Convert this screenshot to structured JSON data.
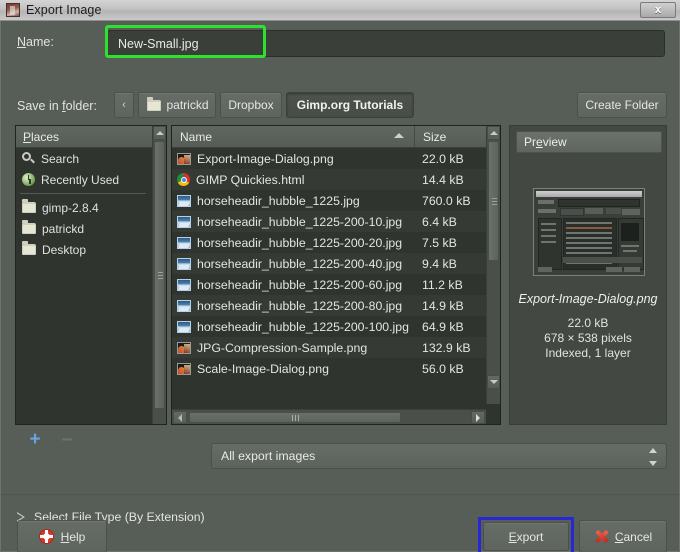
{
  "window": {
    "title": "Export Image",
    "icon": "gimp-wilber-icon",
    "close_label": "x"
  },
  "name_row": {
    "label": "Name:",
    "label_mnemonic": "N",
    "value": "New-Small.jpg",
    "placeholder": "",
    "highlight_color": "#2de12d"
  },
  "folder_row": {
    "label": "Save in folder:",
    "label_mnemonic": "f",
    "back_label": "‹",
    "crumbs": [
      {
        "label": "patrickd",
        "icon": "folder-icon",
        "active": false
      },
      {
        "label": "Dropbox",
        "icon": "",
        "active": false
      },
      {
        "label": "Gimp.org Tutorials",
        "icon": "",
        "active": true
      }
    ],
    "create_folder_label": "Create Folder"
  },
  "places": {
    "header": "Places",
    "header_mnemonic": "P",
    "items": [
      {
        "label": "Search",
        "icon": "search-icon"
      },
      {
        "label": "Recently Used",
        "icon": "recently-used-icon"
      },
      {
        "label": "gimp-2.8.4",
        "icon": "folder-icon"
      },
      {
        "label": "patrickd",
        "icon": "folder-icon"
      },
      {
        "label": "Desktop",
        "icon": "folder-icon"
      }
    ],
    "add_label": "+",
    "remove_label": "–"
  },
  "files": {
    "columns": [
      "Name",
      "Size"
    ],
    "sort_column": "Name",
    "sort_direction": "ascending",
    "rows": [
      {
        "name": "Export-Image-Dialog.png",
        "size": "22.0 kB",
        "icon": "png-image-icon"
      },
      {
        "name": "GIMP Quickies.html",
        "size": "14.4 kB",
        "icon": "chrome-html-icon"
      },
      {
        "name": "horseheadir_hubble_1225.jpg",
        "size": "760.0 kB",
        "icon": "jpg-image-icon"
      },
      {
        "name": "horseheadir_hubble_1225-200-10.jpg",
        "size": "6.4 kB",
        "icon": "jpg-image-icon"
      },
      {
        "name": "horseheadir_hubble_1225-200-20.jpg",
        "size": "7.5 kB",
        "icon": "jpg-image-icon"
      },
      {
        "name": "horseheadir_hubble_1225-200-40.jpg",
        "size": "9.4 kB",
        "icon": "jpg-image-icon"
      },
      {
        "name": "horseheadir_hubble_1225-200-60.jpg",
        "size": "11.2 kB",
        "icon": "jpg-image-icon"
      },
      {
        "name": "horseheadir_hubble_1225-200-80.jpg",
        "size": "14.9 kB",
        "icon": "jpg-image-icon"
      },
      {
        "name": "horseheadir_hubble_1225-200-100.jpg",
        "size": "64.9 kB",
        "icon": "jpg-image-icon"
      },
      {
        "name": "JPG-Compression-Sample.png",
        "size": "132.9 kB",
        "icon": "png-image-icon"
      },
      {
        "name": "Scale-Image-Dialog.png",
        "size": "56.0 kB",
        "icon": "png-image-icon"
      }
    ]
  },
  "preview": {
    "header": "Preview",
    "header_mnemonic": "e",
    "filename": "Export-Image-Dialog.png",
    "size": "22.0 kB",
    "dimensions": "678 × 538 pixels",
    "mode": "Indexed, 1 layer"
  },
  "filter": {
    "value": "All export images"
  },
  "expander": {
    "label": "Select File Type (By Extension)",
    "expanded": false
  },
  "buttons": {
    "help": "Help",
    "help_mnemonic": "H",
    "export": "Export",
    "export_mnemonic": "E",
    "cancel": "Cancel",
    "cancel_mnemonic": "C",
    "export_focus_color": "#2727d6"
  }
}
